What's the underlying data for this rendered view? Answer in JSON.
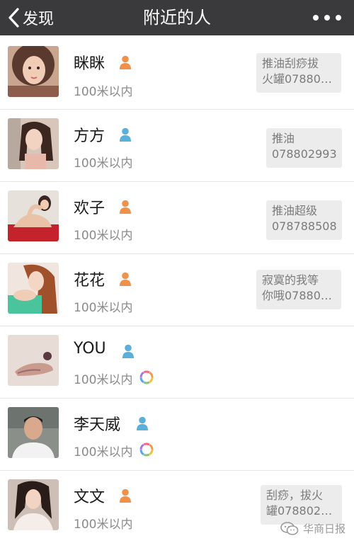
{
  "navbar": {
    "back_label": "发现",
    "title": "附近的人",
    "back_icon": "chevron-left-icon",
    "more_icon": "more-dots-icon",
    "background": "#3a3a3c"
  },
  "colors": {
    "female": "#f0914a",
    "male": "#5ab0d8",
    "signature_bg": "#ececec"
  },
  "people": [
    {
      "name": "眯眯",
      "gender": "female",
      "distance": "100米以内",
      "signature": [
        "推油刮痧拔",
        "火罐07880…"
      ],
      "moments": false
    },
    {
      "name": "方方",
      "gender": "male",
      "distance": "100米以内",
      "signature": [
        "推油",
        "078802993"
      ],
      "moments": false
    },
    {
      "name": "欢子",
      "gender": "female",
      "distance": "100米以内",
      "signature": [
        "推油超级",
        "078788508"
      ],
      "moments": false
    },
    {
      "name": "花花",
      "gender": "female",
      "distance": "100米以内",
      "signature": [
        "寂寞的我等",
        "你哦07880…"
      ],
      "moments": false
    },
    {
      "name": "YOU",
      "gender": "male",
      "distance": "100米以内",
      "signature": [],
      "moments": true
    },
    {
      "name": "李天威",
      "gender": "male",
      "distance": "100米以内",
      "signature": [],
      "moments": true
    },
    {
      "name": "文文",
      "gender": "female",
      "distance": "100米以内",
      "signature": [
        "刮痧，拔火",
        "罐078802…"
      ],
      "moments": false
    }
  ],
  "watermark": {
    "text": "华商日报",
    "icon": "wechat-logo-icon"
  }
}
